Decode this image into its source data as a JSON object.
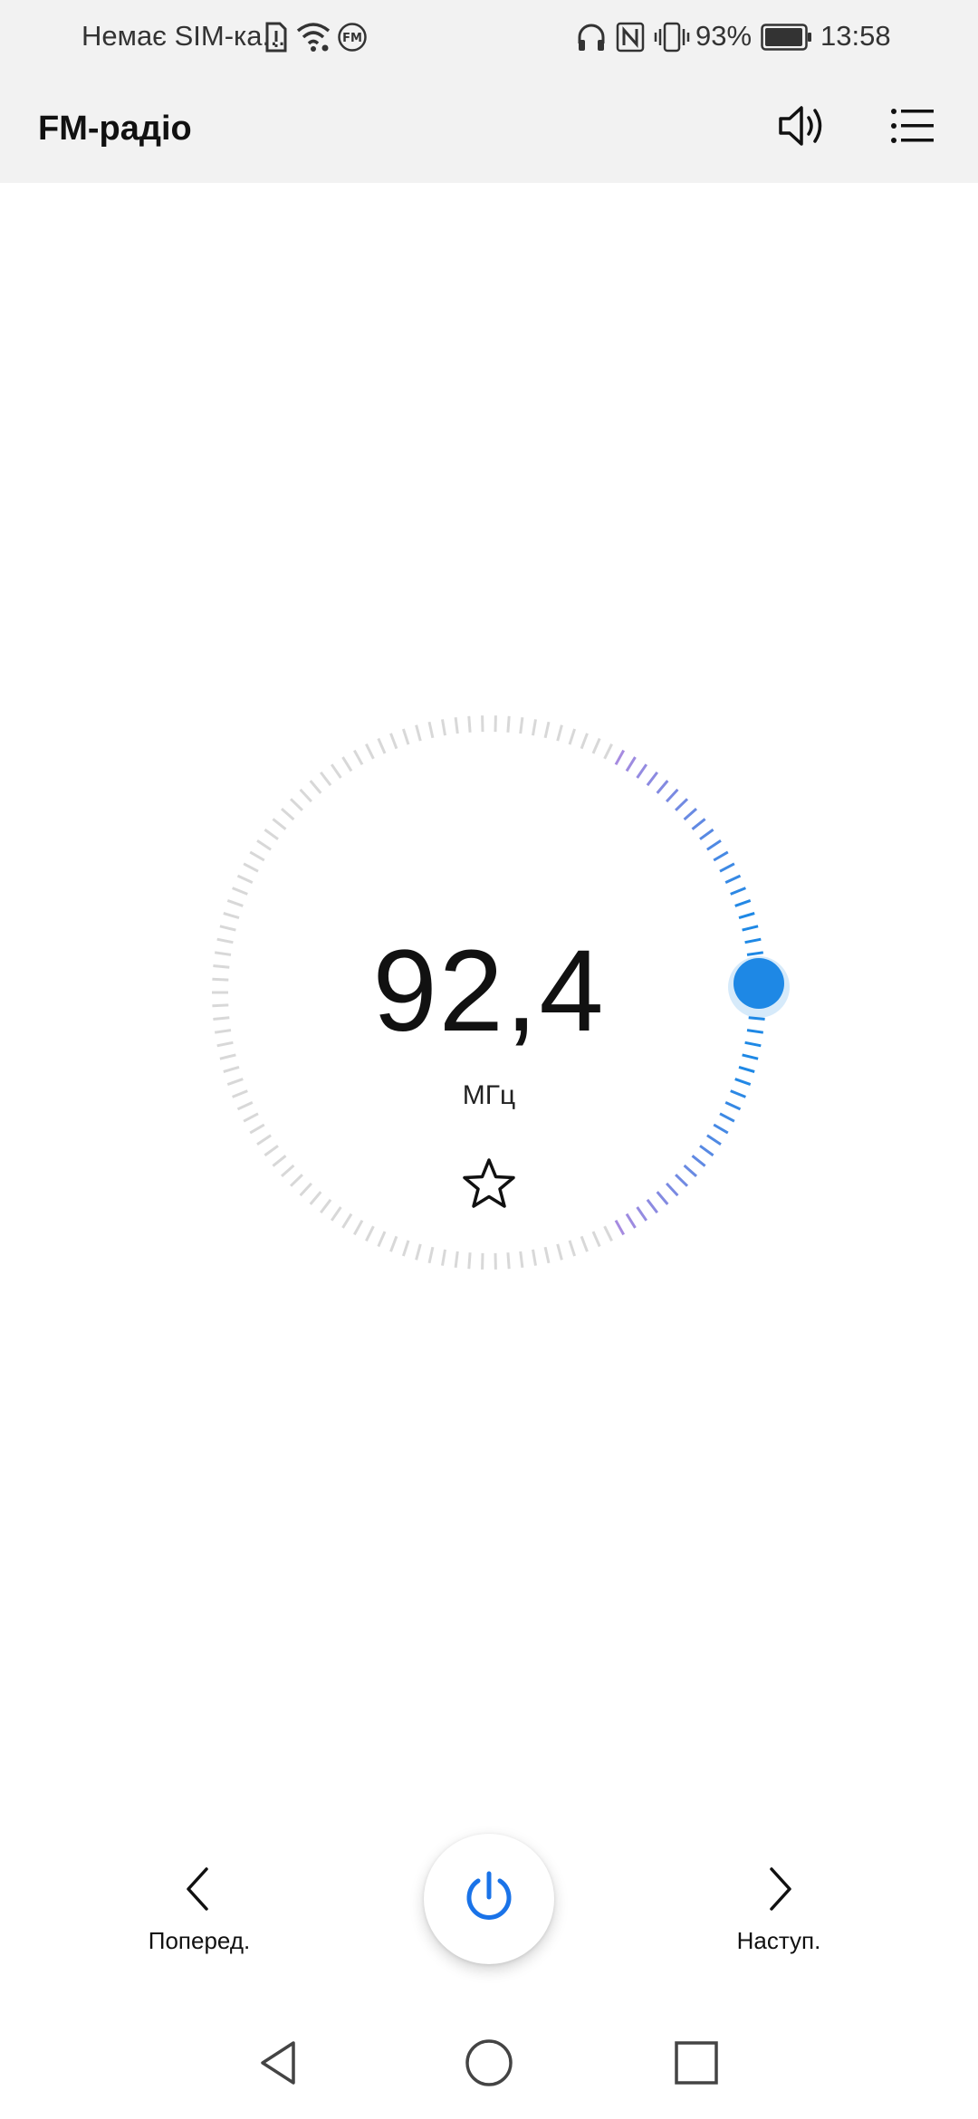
{
  "status_bar": {
    "carrier": "Немає SIM-ка...",
    "battery": "93%",
    "time": "13:58",
    "icons": [
      "sim-alert-icon",
      "wifi-icon",
      "fm-icon",
      "headphones-icon",
      "nfc-icon",
      "vibrate-icon",
      "battery-icon"
    ]
  },
  "app_bar": {
    "title": "FM-радіо",
    "actions": [
      "volume-icon",
      "list-icon"
    ]
  },
  "tuner": {
    "frequency": "92,4",
    "unit": "МГц",
    "favorite_icon": "star-outline-icon",
    "accent_color": "#1a73e8",
    "ring_color": "#d8d8d8",
    "gradient_colors": [
      "#a98be0",
      "#1e88e5"
    ]
  },
  "controls": {
    "prev_label": "Поперед.",
    "next_label": "Наступ.",
    "power_icon": "power-icon"
  },
  "system_nav": {
    "icons": [
      "back-icon",
      "home-icon",
      "recents-icon"
    ]
  }
}
